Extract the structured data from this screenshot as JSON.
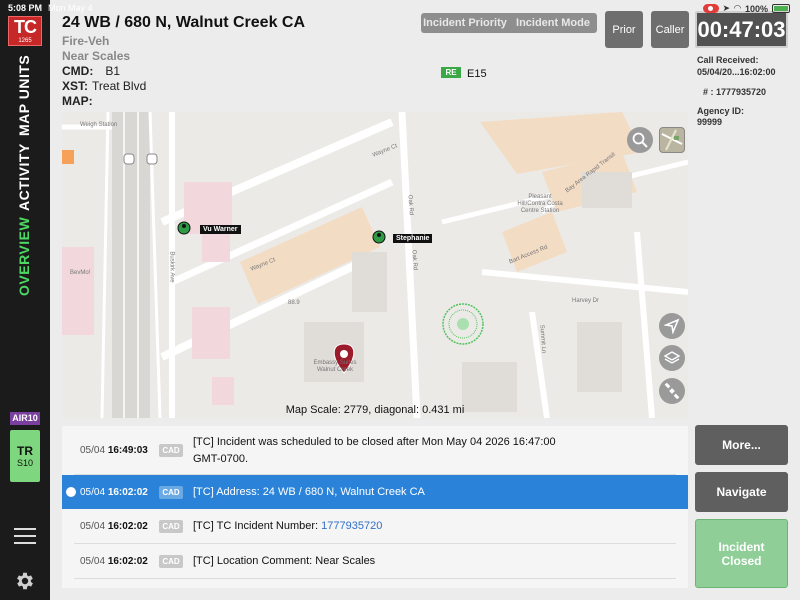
{
  "status": {
    "time": "5:08 PM",
    "date": "Mon May 4",
    "battery": "100%"
  },
  "sidebar": {
    "logo_main": "TC",
    "logo_sub": "1265",
    "tabs": [
      {
        "label": "MAP UNITS"
      },
      {
        "label": "ACTIVITY"
      },
      {
        "label": "OVERVIEW"
      }
    ],
    "air_badge": "AIR10",
    "unit_card": {
      "line1": "TR",
      "line2": "S10"
    }
  },
  "incident": {
    "title": "24 WB / 680 N, Walnut Creek CA",
    "type": "Fire-Veh",
    "location_comment": "Near Scales",
    "cmd_label": "CMD:",
    "cmd_value": "B1",
    "xst_label": "XST:",
    "xst_value": "Treat Blvd",
    "map_label": "MAP:"
  },
  "header": {
    "priority_label": "Incident Priority",
    "mode_label": "Incident Mode",
    "prior_button": "Prior",
    "caller_button": "Caller",
    "timer": "00:47:03",
    "re_badge": "RE",
    "unit_label": "E15",
    "call_received_label": "Call Received:",
    "call_received_value": "05/04/20...16:02:00",
    "number_label": "# : 1777935720",
    "agency_label": "Agency ID:",
    "agency_value": "99999"
  },
  "map": {
    "scale_text": "Map Scale: 2779, diagonal: 0.431 mi",
    "labels": {
      "weigh_station": "Weigh Station",
      "wayne_ct": "Wayne Ct",
      "wayne_ct2": "Wayne Ct",
      "oak_rd": "Oak Rd",
      "oak_rd2": "Oak Rd",
      "buskirk": "Buskirk Ave",
      "bevmo": "BevMo!",
      "station": "Pleasant Hill/Contra Costa Centre Station",
      "bay_area": "Bay Area Rapid Transit",
      "bart_access": "Bart Access Rd",
      "harvey": "Harvey Dr",
      "summit": "Summit Ln",
      "embassy": "Embassy Suites Walnut Creek",
      "num": "88.9"
    },
    "pins": [
      {
        "name": "Vu Warner"
      },
      {
        "name": "Stephanie"
      }
    ]
  },
  "log": [
    {
      "date": "05/04",
      "time": "16:49:03",
      "source": "CAD",
      "line1": "[TC] Incident was scheduled to be closed after Mon May 04 2026 16:47:00",
      "line2": "GMT-0700."
    },
    {
      "date": "05/04",
      "time": "16:02:02",
      "source": "CAD",
      "text": "[TC] Address: 24 WB / 680 N, Walnut Creek CA"
    },
    {
      "date": "05/04",
      "time": "16:02:02",
      "source": "CAD",
      "text": "[TC] TC Incident Number: ",
      "link": "1777935720"
    },
    {
      "date": "05/04",
      "time": "16:02:02",
      "source": "CAD",
      "text": "[TC] Location Comment: Near Scales"
    }
  ],
  "actions": {
    "more": "More...",
    "navigate": "Navigate",
    "incident_closed_1": "Incident",
    "incident_closed_2": "Closed"
  },
  "colors": {
    "accent_green": "#4cd964",
    "selected_blue": "#2b83d9",
    "logo_red": "#c62828",
    "air_purple": "#7b3fa0"
  }
}
